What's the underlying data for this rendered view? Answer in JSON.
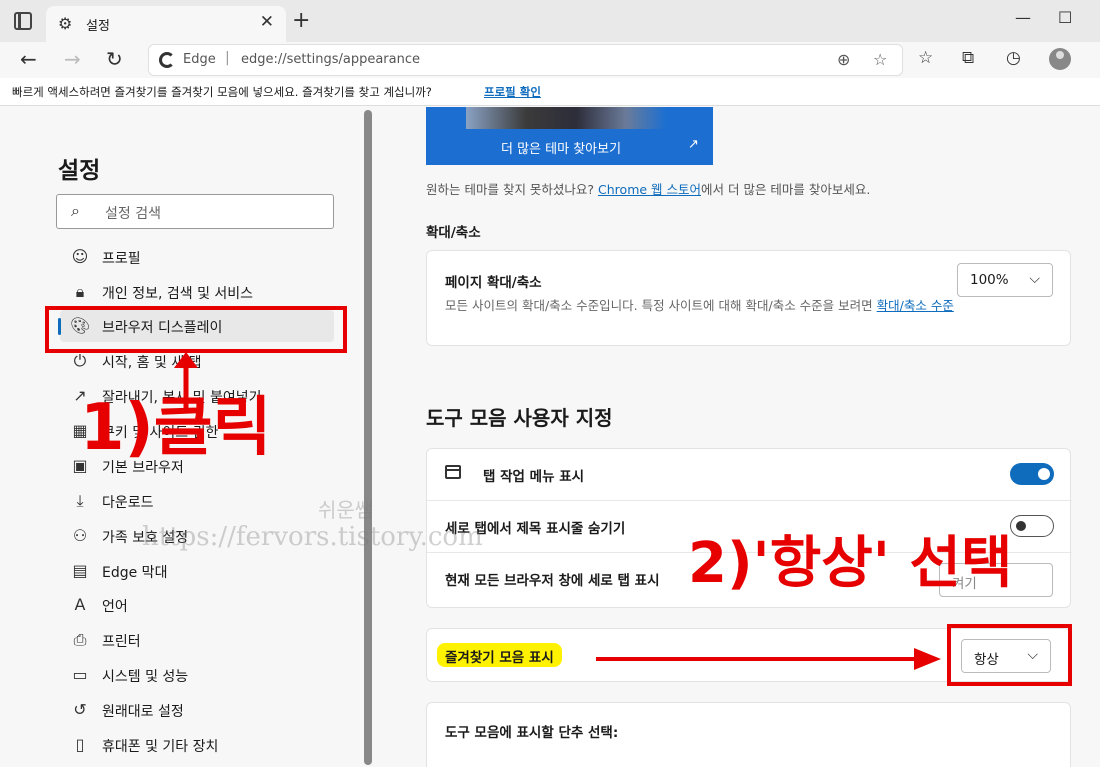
{
  "browser": {
    "tab_title": "설정",
    "address_brand": "Edge",
    "address_separator": "|",
    "url": "edge://settings/appearance"
  },
  "infobar": {
    "text": "빠르게 액세스하려면 즐겨찾기를 즐겨찾기 모음에 넣으세요. 즐겨찾기를 찾고 계십니까?",
    "link": "프로필 확인"
  },
  "sidebar": {
    "title": "설정",
    "search_placeholder": "설정 검색",
    "items": [
      {
        "label": "프로필",
        "icon": "profile-icon"
      },
      {
        "label": "개인 정보, 검색 및 서비스",
        "icon": "lock-icon"
      },
      {
        "label": "브라우저 디스플레이",
        "icon": "palette-icon",
        "active": true
      },
      {
        "label": "시작, 홈 및 새 탭",
        "icon": "power-icon"
      },
      {
        "label": "잘라내기, 복사 및 붙여넣기",
        "icon": "share-icon"
      },
      {
        "label": "쿠키 및 사이트 권한",
        "icon": "cookie-icon"
      },
      {
        "label": "기본 브라우저",
        "icon": "browser-icon"
      },
      {
        "label": "다운로드",
        "icon": "download-icon"
      },
      {
        "label": "가족 보호 설정",
        "icon": "family-icon"
      },
      {
        "label": "Edge 막대",
        "icon": "edge-bar-icon"
      },
      {
        "label": "언어",
        "icon": "language-icon"
      },
      {
        "label": "프린터",
        "icon": "printer-icon"
      },
      {
        "label": "시스템 및 성능",
        "icon": "laptop-icon"
      },
      {
        "label": "원래대로 설정",
        "icon": "reset-icon"
      },
      {
        "label": "휴대폰 및 기타 장치",
        "icon": "phone-icon"
      }
    ]
  },
  "main": {
    "theme_button": "더 많은 테마 찾아보기",
    "not_found_prefix": "원하는 테마를 찾지 못하셨나요? ",
    "not_found_link": "Chrome 웹 스토어",
    "not_found_suffix": "에서 더 많은 테마를 찾아보세요.",
    "zoom_section": "확대/축소",
    "page_zoom_title": "페이지 확대/축소",
    "page_zoom_desc": "모든 사이트의 확대/축소 수준입니다. 특정 사이트에 대해 확대/축소 수준을 보려면 ",
    "page_zoom_link": "확대/축소 수준",
    "page_zoom_value": "100%",
    "toolbar_title": "도구 모음 사용자 지정",
    "tab_actions_label": "탭 작업 메뉴 표시",
    "tab_actions_on": true,
    "vertical_hide_title_label": "세로 탭에서 제목 표시줄 숨기기",
    "vertical_hide_title_on": false,
    "vertical_tabs_label": "현재 모든 브라우저 창에 세로 탭 표시",
    "vertical_tabs_button": "켜기",
    "favorites_bar_label": "즐겨찾기 모음 표시",
    "favorites_bar_value": "항상",
    "toolbar_buttons_label": "도구 모음에 표시할 단추 선택:"
  },
  "annotations": {
    "step1": "1)클릭",
    "step2": "2)'항상' 선택",
    "watermark_name": "쉬운쌤",
    "watermark_url": "https://fervors.tistory.com"
  },
  "colors": {
    "accent": "#0f6cbd",
    "annotation_red": "#e60000",
    "highlight_yellow": "#fff200"
  }
}
